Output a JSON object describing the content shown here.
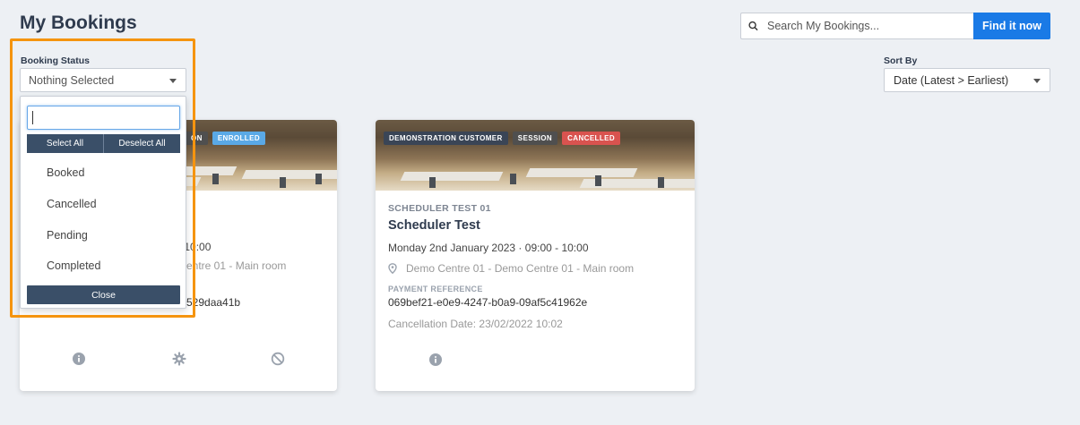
{
  "header": {
    "title": "My Bookings",
    "search_placeholder": "Search My Bookings...",
    "find_label": "Find it now"
  },
  "filters": {
    "status_label": "Booking Status",
    "status_value": "Nothing Selected",
    "sort_label": "Sort By",
    "sort_value": "Date (Latest > Earliest)"
  },
  "dropdown": {
    "search_value": "",
    "select_all": "Select All",
    "deselect_all": "Deselect All",
    "options": [
      "Booked",
      "Cancelled",
      "Pending",
      "Completed"
    ],
    "close_label": "Close"
  },
  "cards": [
    {
      "badges": [
        "ON",
        "ENROLLED"
      ],
      "date_fragment": ":00 - 10:00",
      "location_fragment": "entre 01 - Main room",
      "ref_fragment": "529daa41b"
    },
    {
      "badges": [
        "DEMONSTRATION CUSTOMER",
        "SESSION",
        "CANCELLED"
      ],
      "subtitle": "SCHEDULER TEST 01",
      "title": "Scheduler Test",
      "date": "Monday 2nd January 2023 · 09:00 - 10:00",
      "location": "Demo Centre 01 - Demo Centre 01 - Main room",
      "payment_label": "PAYMENT REFERENCE",
      "payment_ref": "069bef21-e0e9-4247-b0a9-09af5c41962e",
      "cancellation": "Cancellation Date: 23/02/2022 10:02"
    }
  ],
  "colors": {
    "accent": "#1a7ae6",
    "highlight": "#f5940f",
    "dark_button": "#3a4f68",
    "cancelled_badge": "#d9534f",
    "enrolled_badge": "#5aa9e6"
  },
  "icons": [
    "search-icon",
    "caret-down-icon",
    "info-icon",
    "gear-icon",
    "ban-icon",
    "map-pin-icon"
  ]
}
